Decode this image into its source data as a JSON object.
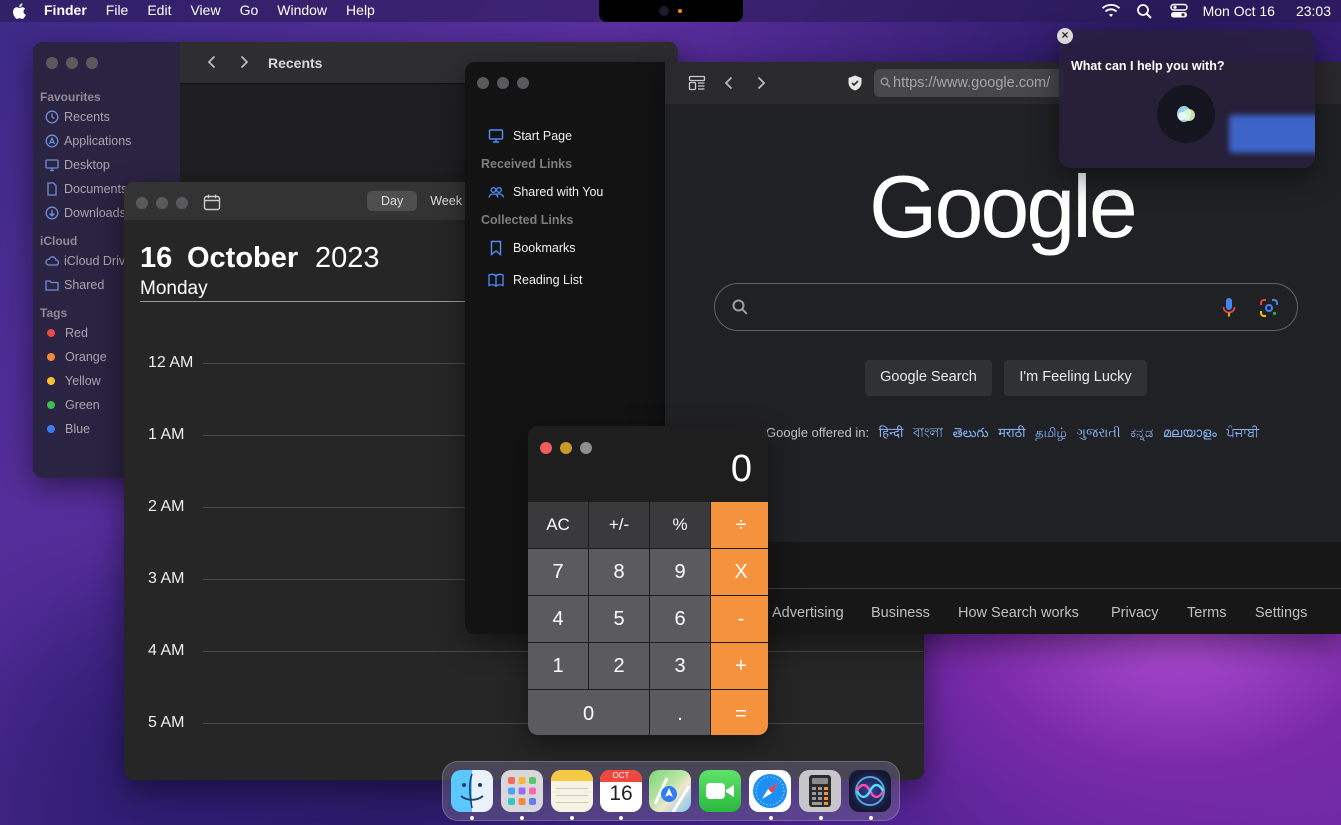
{
  "menubar": {
    "app_name": "Finder",
    "items": [
      "File",
      "Edit",
      "View",
      "Go",
      "Window",
      "Help"
    ],
    "date": "Mon Oct 16",
    "time": "23:03"
  },
  "finder": {
    "title": "Recents",
    "favourites_label": "Favourites",
    "favourites": [
      "Recents",
      "Applications",
      "Desktop",
      "Documents",
      "Downloads"
    ],
    "icloud_label": "iCloud",
    "icloud": [
      "iCloud Drive",
      "Shared"
    ],
    "tags_label": "Tags",
    "tags": [
      {
        "name": "Red",
        "color": "#ea4a4a"
      },
      {
        "name": "Orange",
        "color": "#f08a3a"
      },
      {
        "name": "Yellow",
        "color": "#f3c234"
      },
      {
        "name": "Green",
        "color": "#3cbf4f"
      },
      {
        "name": "Blue",
        "color": "#3a7cf0"
      }
    ]
  },
  "calendar": {
    "view_day": "Day",
    "view_week": "Week",
    "day": "16",
    "month": "October",
    "year": "2023",
    "weekday": "Monday",
    "hours": [
      "12 AM",
      "1 AM",
      "2 AM",
      "3 AM",
      "4 AM",
      "5 AM"
    ]
  },
  "safari": {
    "sidebar": {
      "start_page": "Start Page",
      "received_links": "Received Links",
      "shared_with_you": "Shared with You",
      "collected_links": "Collected Links",
      "bookmarks": "Bookmarks",
      "reading_list": "Reading List"
    },
    "url": "https://www.google.com/",
    "google": {
      "logo": "Google",
      "search_button": "Google Search",
      "lucky_button": "I'm Feeling Lucky",
      "offered_in": "Google offered in:",
      "languages": [
        "हिन्दी",
        "বাংলা",
        "తెలుగు",
        "मराठी",
        "தமிழ்",
        "ગુજરાતી",
        "ಕನ್ನಡ",
        "മലയാളം",
        "ਪੰਜਾਬੀ"
      ],
      "footer": [
        "Advertising",
        "Business",
        "How Search works",
        "Privacy",
        "Terms",
        "Settings"
      ]
    }
  },
  "siri": {
    "prompt": "What can I help you with?",
    "close": "×"
  },
  "calculator": {
    "display": "0",
    "keys": [
      "AC",
      "+/-",
      "%",
      "÷",
      "7",
      "8",
      "9",
      "X",
      "4",
      "5",
      "6",
      "-",
      "1",
      "2",
      "3",
      "+",
      "0",
      ".",
      "="
    ]
  },
  "dock": {
    "calendar_month": "OCT",
    "calendar_day": "16",
    "apps": [
      "finder-icon",
      "launchpad-icon",
      "notes-icon",
      "calendar-icon",
      "maps-icon",
      "facetime-icon",
      "safari-icon",
      "calculator-icon",
      "siri-icon"
    ]
  }
}
